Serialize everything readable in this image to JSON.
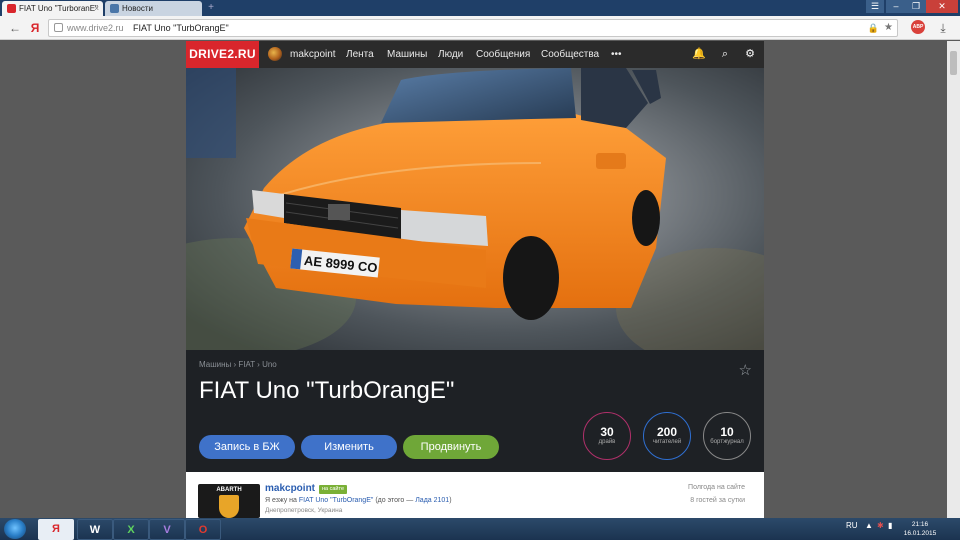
{
  "browser": {
    "tabs": [
      {
        "title": "FIAT Uno \"TurboranE\"",
        "close": "×",
        "active": true
      },
      {
        "title": "Новости",
        "active": false
      }
    ],
    "window_buttons": [
      "☰",
      "–",
      "❐",
      "✕"
    ],
    "url_host": "www.drive2.ru",
    "page_title": "FIAT Uno \"TurbOrangE\"",
    "abp_label": "ABP"
  },
  "site": {
    "logo": "DRIVE2.RU",
    "user": "makcpoint",
    "nav": [
      "Лента",
      "Машины",
      "Люди",
      "Сообщения",
      "Сообщества",
      "•••"
    ],
    "breadcrumb": "Машины › FIAT › Uno",
    "title": "FIAT Uno \"TurbOrangE\"",
    "plate": "AE 8999 CO",
    "buttons": {
      "record": "Запись в БЖ",
      "edit": "Изменить",
      "promote": "Продвинуть"
    },
    "stats": [
      {
        "value": "30",
        "label": "драйв",
        "color": "#b0306a"
      },
      {
        "value": "200",
        "label": "читателей",
        "color": "#2f6fd1"
      },
      {
        "value": "10",
        "label": "бортжурнал",
        "color": "#888888"
      }
    ]
  },
  "owner": {
    "name": "makcpoint",
    "badge": "на сайте",
    "drive_prefix": "Я езжу на",
    "drive_car": "FIAT Uno \"TurbOrangE\"",
    "drive_mid": "(до этого —",
    "drive_prev": "Лада 2101",
    "drive_end": ")",
    "city": "Днепропетровск, Украина",
    "avatar_text": "ABARTH",
    "since": "Полгода на сайте",
    "guests": "8 гостей за сутки"
  },
  "taskbar": {
    "apps": [
      "Я",
      "W",
      "X",
      "V",
      "O"
    ],
    "lang": "RU",
    "time": "21:16",
    "date": "16.01.2015"
  },
  "colors": {
    "brand_red": "#d9262c",
    "button_blue": "#3f72c9",
    "button_green": "#6fa738",
    "link": "#2a5db0"
  }
}
